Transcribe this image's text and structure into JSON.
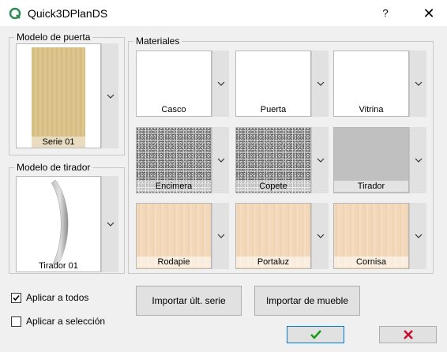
{
  "window": {
    "title": "Quick3DPlanDS",
    "help_label": "?",
    "close_label": "✕",
    "icon": "app-q-icon"
  },
  "door_model": {
    "group_label": "Modelo de puerta",
    "caption": "Serie 01"
  },
  "handle_model": {
    "group_label": "Modelo de tirador",
    "caption": "Tirador 01"
  },
  "materials": {
    "group_label": "Materiales",
    "items": [
      {
        "label": "Casco",
        "texture": "white"
      },
      {
        "label": "Puerta",
        "texture": "white"
      },
      {
        "label": "Vitrina",
        "texture": "white"
      },
      {
        "label": "Encimera",
        "texture": "granite"
      },
      {
        "label": "Copete",
        "texture": "granite"
      },
      {
        "label": "Tirador",
        "texture": "grey"
      },
      {
        "label": "Rodapie",
        "texture": "wood-light"
      },
      {
        "label": "Portaluz",
        "texture": "wood-light"
      },
      {
        "label": "Cornisa",
        "texture": "wood-light"
      }
    ]
  },
  "options": {
    "apply_all_label": "Aplicar a todos",
    "apply_all_checked": true,
    "apply_selection_label": "Aplicar a selección",
    "apply_selection_checked": false
  },
  "buttons": {
    "import_series": "Importar últ. serie",
    "import_furniture": "Importar de mueble",
    "ok_icon": "checkmark-icon",
    "cancel_icon": "x-icon"
  },
  "colors": {
    "ok_green": "#1a9b1a",
    "cancel_red": "#c8102e",
    "wood_door": "#d8bf86",
    "wood_light": "#f3d9bb",
    "grey_material": "#c0c0c0"
  }
}
